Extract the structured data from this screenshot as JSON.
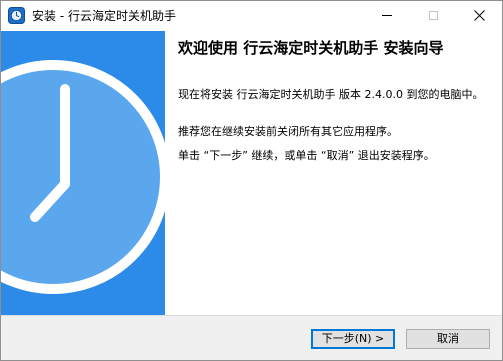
{
  "window": {
    "title": "安装 - 行云海定时关机助手"
  },
  "content": {
    "heading": "欢迎使用 行云海定时关机助手 安装向导",
    "paragraph_1": "现在将安装 行云海定时关机助手 版本 2.4.0.0 到您的电脑中。",
    "paragraph_2": "推荐您在继续安装前关闭所有其它应用程序。",
    "paragraph_3": "单击 “下一步” 继续，或单击 “取消” 退出安装程序。"
  },
  "buttons": {
    "next_label": "下一步(N) >",
    "cancel_label": "取消"
  },
  "colors": {
    "banner": "#2c8be8",
    "clock_face": "#5aa7ee",
    "primary_button_border": "#0078d7"
  },
  "icons": [
    "app-icon",
    "minimize-icon",
    "maximize-icon",
    "close-icon",
    "clock-illustration"
  ]
}
